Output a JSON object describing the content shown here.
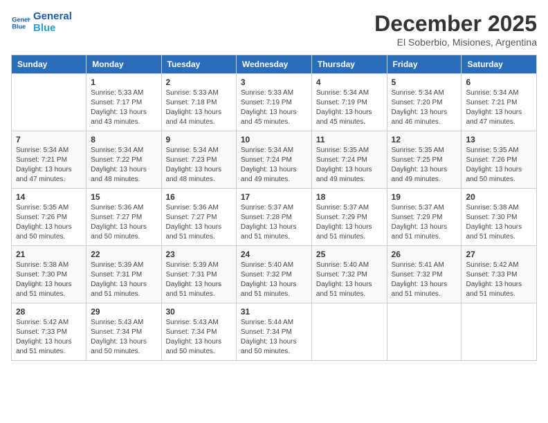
{
  "logo": {
    "line1": "General",
    "line2": "Blue"
  },
  "title": "December 2025",
  "subtitle": "El Soberbio, Misiones, Argentina",
  "headers": [
    "Sunday",
    "Monday",
    "Tuesday",
    "Wednesday",
    "Thursday",
    "Friday",
    "Saturday"
  ],
  "weeks": [
    [
      {
        "day": "",
        "info": ""
      },
      {
        "day": "1",
        "info": "Sunrise: 5:33 AM\nSunset: 7:17 PM\nDaylight: 13 hours\nand 43 minutes."
      },
      {
        "day": "2",
        "info": "Sunrise: 5:33 AM\nSunset: 7:18 PM\nDaylight: 13 hours\nand 44 minutes."
      },
      {
        "day": "3",
        "info": "Sunrise: 5:33 AM\nSunset: 7:19 PM\nDaylight: 13 hours\nand 45 minutes."
      },
      {
        "day": "4",
        "info": "Sunrise: 5:34 AM\nSunset: 7:19 PM\nDaylight: 13 hours\nand 45 minutes."
      },
      {
        "day": "5",
        "info": "Sunrise: 5:34 AM\nSunset: 7:20 PM\nDaylight: 13 hours\nand 46 minutes."
      },
      {
        "day": "6",
        "info": "Sunrise: 5:34 AM\nSunset: 7:21 PM\nDaylight: 13 hours\nand 47 minutes."
      }
    ],
    [
      {
        "day": "7",
        "info": "Sunrise: 5:34 AM\nSunset: 7:21 PM\nDaylight: 13 hours\nand 47 minutes."
      },
      {
        "day": "8",
        "info": "Sunrise: 5:34 AM\nSunset: 7:22 PM\nDaylight: 13 hours\nand 48 minutes."
      },
      {
        "day": "9",
        "info": "Sunrise: 5:34 AM\nSunset: 7:23 PM\nDaylight: 13 hours\nand 48 minutes."
      },
      {
        "day": "10",
        "info": "Sunrise: 5:34 AM\nSunset: 7:24 PM\nDaylight: 13 hours\nand 49 minutes."
      },
      {
        "day": "11",
        "info": "Sunrise: 5:35 AM\nSunset: 7:24 PM\nDaylight: 13 hours\nand 49 minutes."
      },
      {
        "day": "12",
        "info": "Sunrise: 5:35 AM\nSunset: 7:25 PM\nDaylight: 13 hours\nand 49 minutes."
      },
      {
        "day": "13",
        "info": "Sunrise: 5:35 AM\nSunset: 7:26 PM\nDaylight: 13 hours\nand 50 minutes."
      }
    ],
    [
      {
        "day": "14",
        "info": "Sunrise: 5:35 AM\nSunset: 7:26 PM\nDaylight: 13 hours\nand 50 minutes."
      },
      {
        "day": "15",
        "info": "Sunrise: 5:36 AM\nSunset: 7:27 PM\nDaylight: 13 hours\nand 50 minutes."
      },
      {
        "day": "16",
        "info": "Sunrise: 5:36 AM\nSunset: 7:27 PM\nDaylight: 13 hours\nand 51 minutes."
      },
      {
        "day": "17",
        "info": "Sunrise: 5:37 AM\nSunset: 7:28 PM\nDaylight: 13 hours\nand 51 minutes."
      },
      {
        "day": "18",
        "info": "Sunrise: 5:37 AM\nSunset: 7:29 PM\nDaylight: 13 hours\nand 51 minutes."
      },
      {
        "day": "19",
        "info": "Sunrise: 5:37 AM\nSunset: 7:29 PM\nDaylight: 13 hours\nand 51 minutes."
      },
      {
        "day": "20",
        "info": "Sunrise: 5:38 AM\nSunset: 7:30 PM\nDaylight: 13 hours\nand 51 minutes."
      }
    ],
    [
      {
        "day": "21",
        "info": "Sunrise: 5:38 AM\nSunset: 7:30 PM\nDaylight: 13 hours\nand 51 minutes."
      },
      {
        "day": "22",
        "info": "Sunrise: 5:39 AM\nSunset: 7:31 PM\nDaylight: 13 hours\nand 51 minutes."
      },
      {
        "day": "23",
        "info": "Sunrise: 5:39 AM\nSunset: 7:31 PM\nDaylight: 13 hours\nand 51 minutes."
      },
      {
        "day": "24",
        "info": "Sunrise: 5:40 AM\nSunset: 7:32 PM\nDaylight: 13 hours\nand 51 minutes."
      },
      {
        "day": "25",
        "info": "Sunrise: 5:40 AM\nSunset: 7:32 PM\nDaylight: 13 hours\nand 51 minutes."
      },
      {
        "day": "26",
        "info": "Sunrise: 5:41 AM\nSunset: 7:32 PM\nDaylight: 13 hours\nand 51 minutes."
      },
      {
        "day": "27",
        "info": "Sunrise: 5:42 AM\nSunset: 7:33 PM\nDaylight: 13 hours\nand 51 minutes."
      }
    ],
    [
      {
        "day": "28",
        "info": "Sunrise: 5:42 AM\nSunset: 7:33 PM\nDaylight: 13 hours\nand 51 minutes."
      },
      {
        "day": "29",
        "info": "Sunrise: 5:43 AM\nSunset: 7:34 PM\nDaylight: 13 hours\nand 50 minutes."
      },
      {
        "day": "30",
        "info": "Sunrise: 5:43 AM\nSunset: 7:34 PM\nDaylight: 13 hours\nand 50 minutes."
      },
      {
        "day": "31",
        "info": "Sunrise: 5:44 AM\nSunset: 7:34 PM\nDaylight: 13 hours\nand 50 minutes."
      },
      {
        "day": "",
        "info": ""
      },
      {
        "day": "",
        "info": ""
      },
      {
        "day": "",
        "info": ""
      }
    ]
  ]
}
